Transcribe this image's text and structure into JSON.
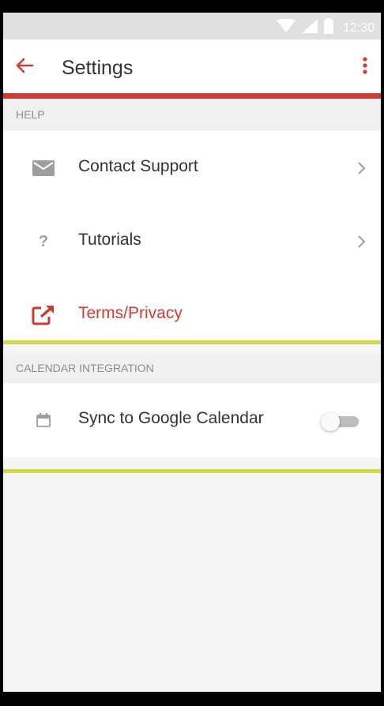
{
  "status_bar": {
    "time": "12:30",
    "icons": [
      "wifi-icon",
      "signal-icon",
      "battery-icon"
    ]
  },
  "app_bar": {
    "title": "Settings",
    "back_icon": "arrow-back-icon",
    "menu_icon": "more-vert-icon"
  },
  "colors": {
    "accent": "#cf3a36",
    "divider_highlight": "#d2d84a",
    "icon_grey": "#9e9e9e"
  },
  "sections": [
    {
      "header": "HELP",
      "items": [
        {
          "label": "Contact Support",
          "icon": "mail-icon",
          "trailing": "chevron-right-icon"
        },
        {
          "label": "Tutorials",
          "icon": "help-icon",
          "trailing": "chevron-right-icon"
        },
        {
          "label": "Terms/Privacy",
          "icon": "open-in-new-icon",
          "trailing": ""
        }
      ]
    },
    {
      "header": "CALENDAR INTEGRATION",
      "items": [
        {
          "label": "Sync to Google Calendar",
          "icon": "calendar-icon",
          "trailing": "toggle",
          "toggle_on": false
        }
      ]
    }
  ]
}
